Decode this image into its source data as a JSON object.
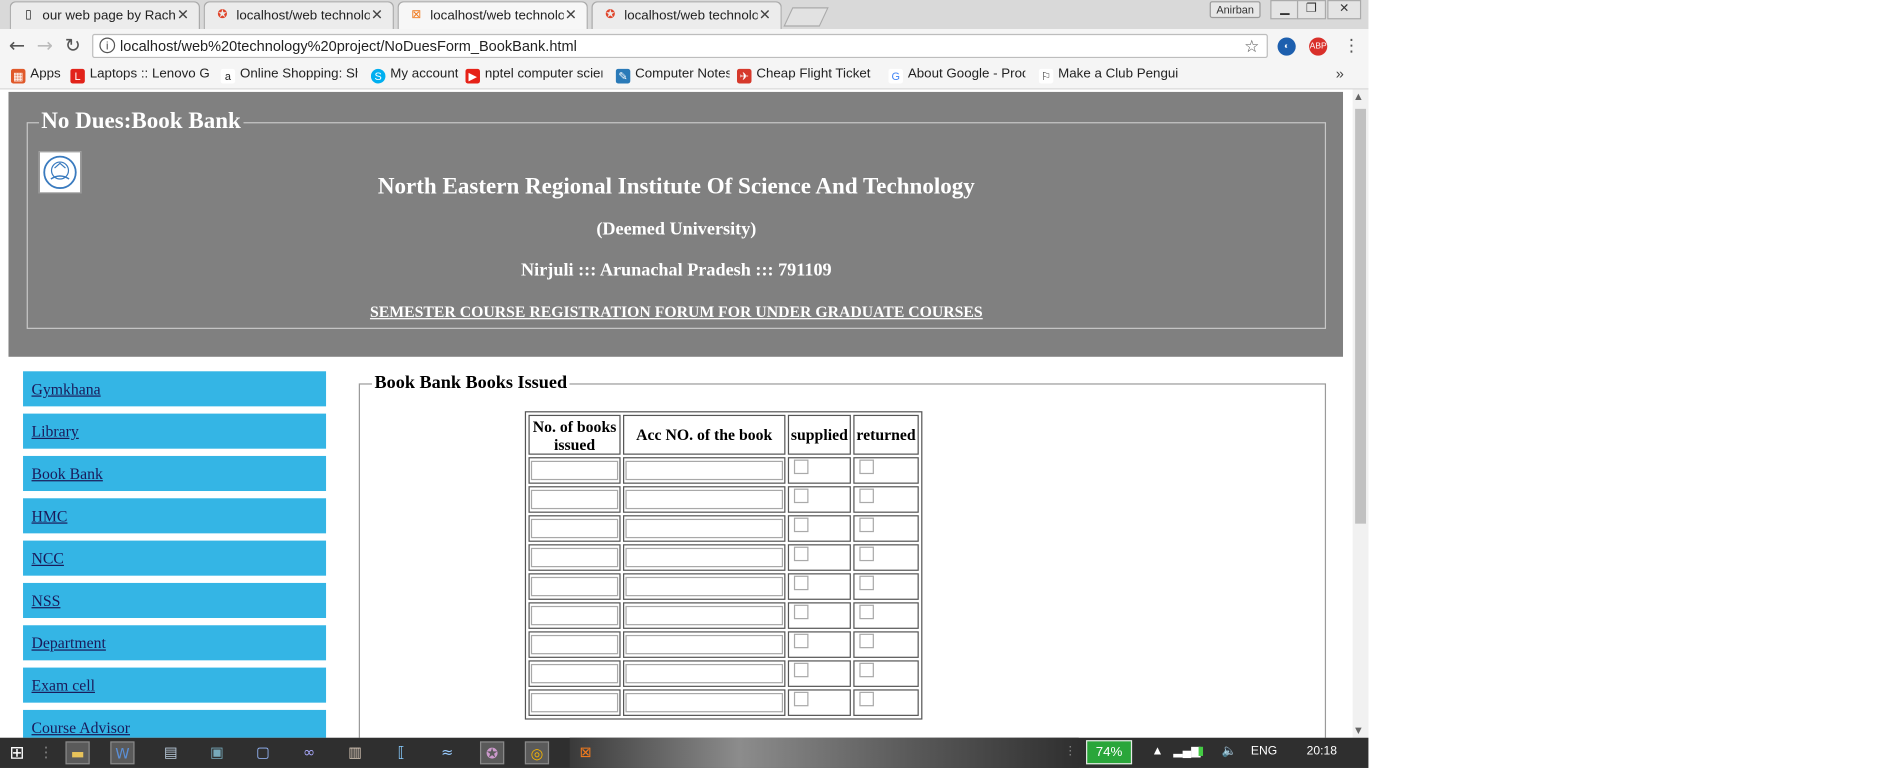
{
  "browser": {
    "tabs": [
      {
        "title": "our web page by Rachna",
        "active": false,
        "icon": "page-icon"
      },
      {
        "title": "localhost/web technolog",
        "active": false,
        "icon": "xampp-icon"
      },
      {
        "title": "localhost/web technolog",
        "active": true,
        "icon": "xampp-icon"
      },
      {
        "title": "localhost/web technolog",
        "active": false,
        "icon": "xampp-icon"
      }
    ],
    "user_badge": "Anirban",
    "address": "localhost/web%20technology%20project/NoDuesForm_BookBank.html",
    "bookmarks": [
      {
        "label": "Apps",
        "icon": "apps-grid-icon",
        "color": "#e0592a"
      },
      {
        "label": "Laptops :: Lenovo G S",
        "icon": "lenovo-icon",
        "color": "#e2231a"
      },
      {
        "label": "Online Shopping: Sho",
        "icon": "amazon-icon",
        "color": "#222222"
      },
      {
        "label": "My account",
        "icon": "skype-icon",
        "color": "#00aff0"
      },
      {
        "label": "nptel computer scienc",
        "icon": "youtube-icon",
        "color": "#e62117"
      },
      {
        "label": "Computer Notes",
        "icon": "notes-icon",
        "color": "#2a7ab8"
      },
      {
        "label": "Cheap Flight Ticket Bo",
        "icon": "flight-icon",
        "color": "#d6392b"
      },
      {
        "label": "About Google - Produ",
        "icon": "google-icon",
        "color": "#4285f4"
      },
      {
        "label": "Make a Club Penguin",
        "icon": "penguin-icon",
        "color": "#2b2b2b"
      }
    ]
  },
  "page": {
    "legend": "No Dues:Book Bank",
    "institute": "North Eastern Regional Institute Of Science And Technology",
    "deemed": "(Deemed University)",
    "address": "Nirjuli ::: Arunachal Pradesh ::: 791109",
    "forum": "SEMESTER COURSE REGISTRATION FORUM FOR UNDER GRADUATE COURSES",
    "nav": [
      "Gymkhana",
      "Library",
      "Book Bank",
      "HMC",
      "NCC",
      "NSS",
      "Department",
      "Exam cell",
      "Course Advisor"
    ],
    "books": {
      "legend": "Book Bank Books Issued",
      "headers": [
        "No. of books issued",
        "Acc NO. of the book",
        "supplied",
        "returned"
      ],
      "row_count": 9
    }
  },
  "taskbar": {
    "battery": "74%",
    "lang": "ENG",
    "time": "20:18"
  },
  "colors": {
    "header_bg": "#808080",
    "nav_bg": "#34b5e5",
    "battery": "#2aa63a"
  }
}
